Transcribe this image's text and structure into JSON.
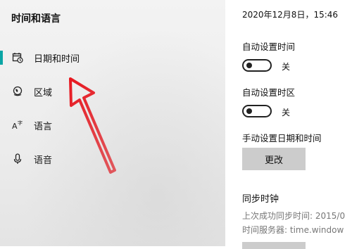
{
  "sidebar": {
    "title": "时间和语言",
    "items": [
      {
        "label": "日期和时间",
        "icon": "calendar-clock-icon",
        "selected": true
      },
      {
        "label": "区域",
        "icon": "globe-icon",
        "selected": false
      },
      {
        "label": "语言",
        "icon": "language-icon",
        "selected": false
      },
      {
        "label": "语音",
        "icon": "microphone-icon",
        "selected": false
      }
    ]
  },
  "main": {
    "datetime": "2020年12月8日，15:46",
    "auto_time": {
      "label": "自动设置时间",
      "state": "关"
    },
    "auto_timezone": {
      "label": "自动设置时区",
      "state": "关"
    },
    "manual": {
      "label": "手动设置日期和时间",
      "button": "更改"
    },
    "sync": {
      "heading": "同步时钟",
      "last_success": "上次成功同步时间: 2015/0",
      "server": "时间服务器: time.window"
    }
  },
  "colors": {
    "accent": "#0aa5a5",
    "annotation": "#e8141c",
    "button": "#cccccc"
  }
}
